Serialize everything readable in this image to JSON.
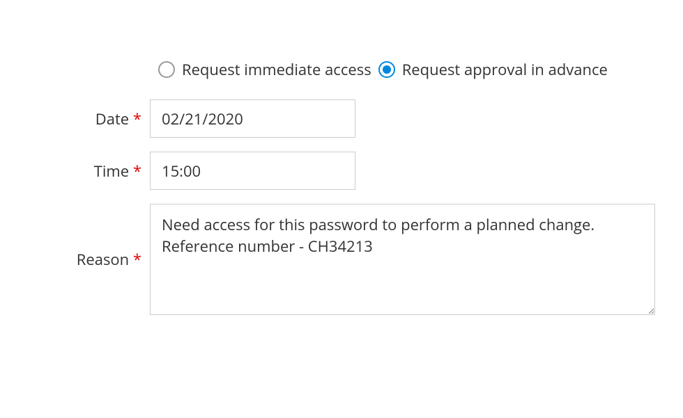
{
  "radio_options": {
    "immediate": {
      "label": "Request immediate access",
      "selected": false
    },
    "advance": {
      "label": "Request approval in advance",
      "selected": true
    }
  },
  "fields": {
    "date": {
      "label": "Date",
      "required_marker": "*",
      "value": "02/21/2020"
    },
    "time": {
      "label": "Time",
      "required_marker": "*",
      "value": "15:00"
    },
    "reason": {
      "label": "Reason",
      "required_marker": "*",
      "value": "Need access for this password to perform a planned change. Reference number - CH34213"
    }
  }
}
